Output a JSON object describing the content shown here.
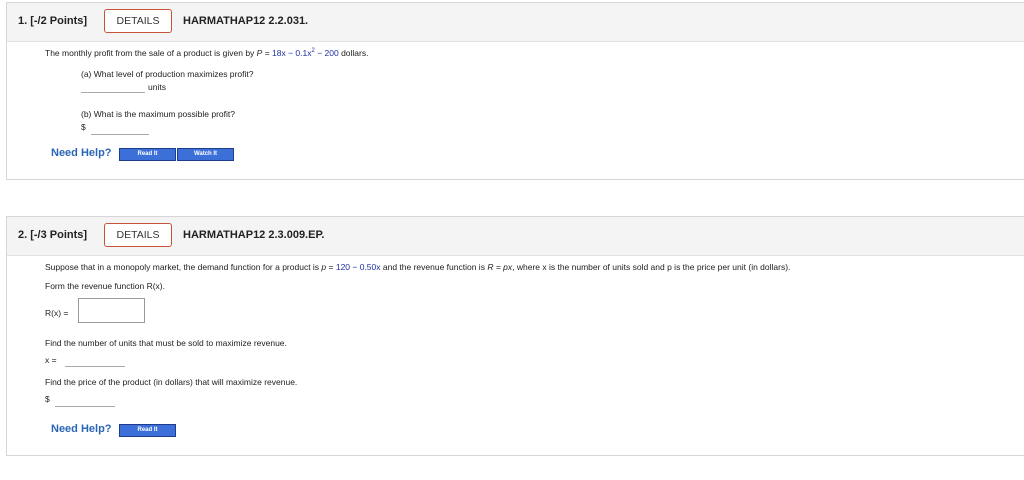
{
  "q1": {
    "number": "1. [-/2 Points]",
    "details": "DETAILS",
    "code": "HARMATHAP12 2.2.031.",
    "stem_prefix": "The monthly profit from the sale of a product is given by ",
    "stem_p": "P",
    "stem_eq": " = ",
    "stem_math_a": "18x − 0.1x",
    "stem_math_sup": "2",
    "stem_math_b": " − 200",
    "stem_suffix": " dollars.",
    "part_a": "(a) What level of production maximizes profit?",
    "units": "units",
    "part_b": "(b) What is the maximum possible profit?",
    "dollar": "$",
    "need_help": "Need Help?",
    "read_it": "Read It",
    "watch_it": "Watch It"
  },
  "q2": {
    "number": "2. [-/3 Points]",
    "details": "DETAILS",
    "code": "HARMATHAP12 2.3.009.EP.",
    "stem_a": "Suppose that in a monopoly market, the demand function for a product is ",
    "stem_p": "p",
    "stem_eq": " = ",
    "stem_math": "120 − 0.50x",
    "stem_b": " and the revenue function is ",
    "stem_R": "R = px",
    "stem_c": ", where x is the number of units sold and p is the price per unit (in dollars).",
    "form_line": "Form the revenue function R(x).",
    "rx_label": "R(x) =",
    "find_units": "Find the number of units that must be sold to maximize revenue.",
    "x_label": "x =",
    "find_price": "Find the price of the product (in dollars) that will maximize revenue.",
    "dollar": "$",
    "need_help": "Need Help?",
    "read_it": "Read It"
  }
}
